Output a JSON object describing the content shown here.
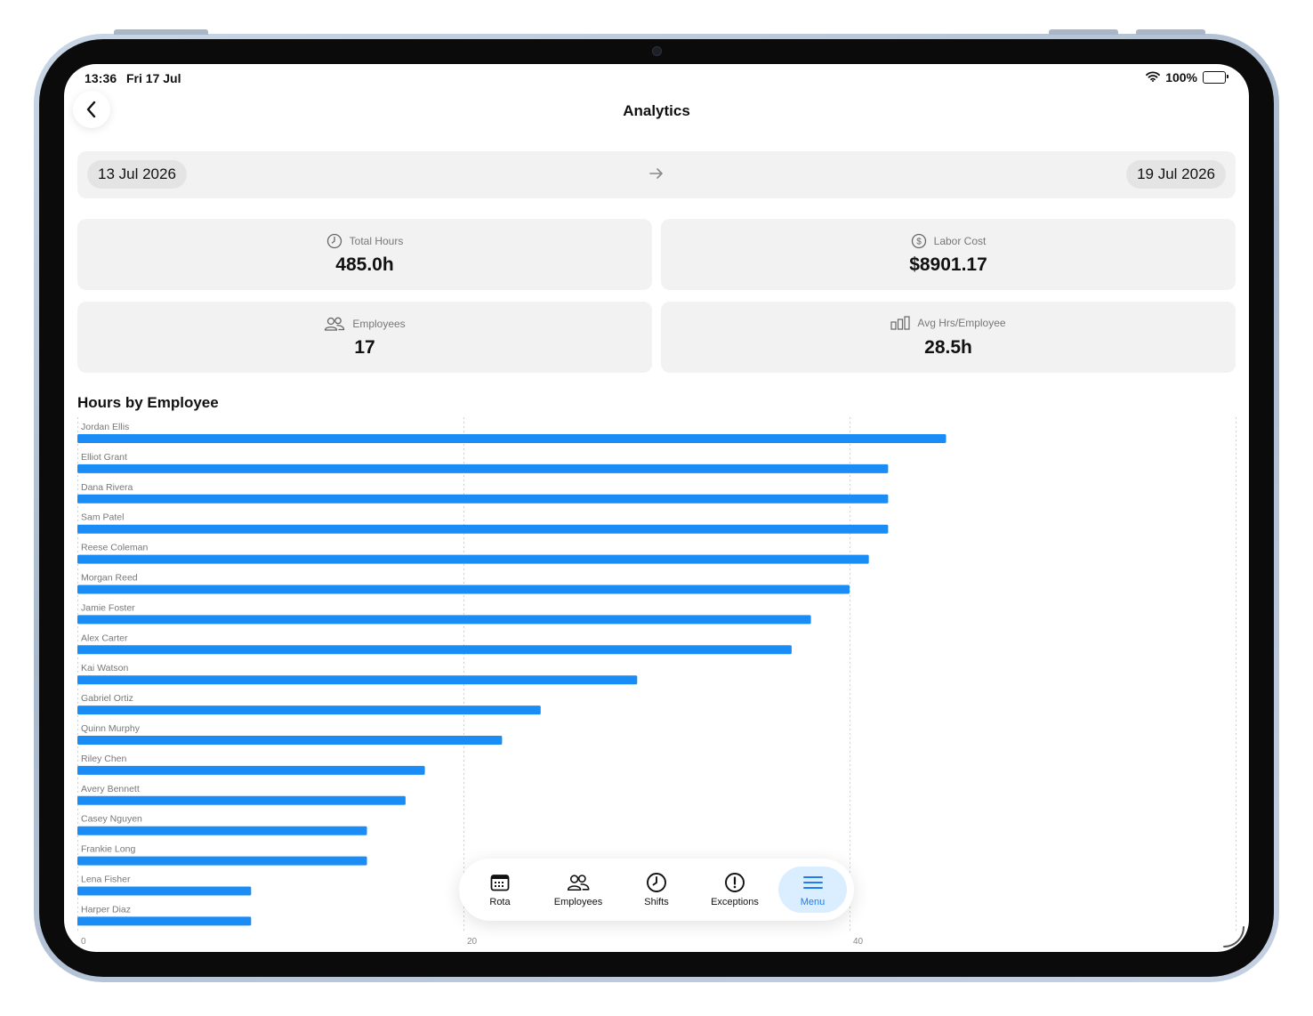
{
  "status_bar": {
    "time": "13:36",
    "date": "Fri 17 Jul",
    "battery": "100%"
  },
  "header": {
    "title": "Analytics"
  },
  "date_range": {
    "start": "13 Jul 2026",
    "end": "19 Jul 2026"
  },
  "stats": {
    "total_hours": {
      "label": "Total Hours",
      "value": "485.0h",
      "icon": "clock-icon"
    },
    "labor_cost": {
      "label": "Labor Cost",
      "value": "$8901.17",
      "icon": "dollar-circle-icon"
    },
    "employees": {
      "label": "Employees",
      "value": "17",
      "icon": "people-icon"
    },
    "avg_hours": {
      "label": "Avg Hrs/Employee",
      "value": "28.5h",
      "icon": "bar-chart-icon"
    }
  },
  "chart_title": "Hours by Employee",
  "chart_data": {
    "type": "bar",
    "orientation": "horizontal",
    "categories": [
      "Jordan Ellis",
      "Elliot Grant",
      "Dana Rivera",
      "Sam Patel",
      "Reese Coleman",
      "Morgan Reed",
      "Jamie Foster",
      "Alex Carter",
      "Kai Watson",
      "Gabriel Ortiz",
      "Quinn Murphy",
      "Riley Chen",
      "Avery Bennett",
      "Casey Nguyen",
      "Frankie Long",
      "Lena Fisher",
      "Harper Diaz"
    ],
    "values": [
      45,
      42,
      42,
      42,
      41,
      40,
      38,
      37,
      29,
      24,
      22,
      18,
      17,
      15,
      15,
      9,
      9
    ],
    "x_ticks": [
      "0",
      "20",
      "40"
    ],
    "xlim": [
      0,
      60
    ],
    "grid": true,
    "bar_color": "#1a8cf5"
  },
  "tab_bar": {
    "tabs": [
      {
        "label": "Rota",
        "icon": "calendar-icon",
        "active": false
      },
      {
        "label": "Employees",
        "icon": "people-icon",
        "active": false
      },
      {
        "label": "Shifts",
        "icon": "clock-icon",
        "active": false
      },
      {
        "label": "Exceptions",
        "icon": "exclamation-circle-icon",
        "active": false
      },
      {
        "label": "Menu",
        "icon": "menu-icon",
        "active": true
      }
    ]
  },
  "colors": {
    "accent": "#1a8cf5",
    "card_bg": "#f2f2f2",
    "active_tab_bg": "#dbeeff",
    "active_tab_text": "#1e7ef0"
  }
}
